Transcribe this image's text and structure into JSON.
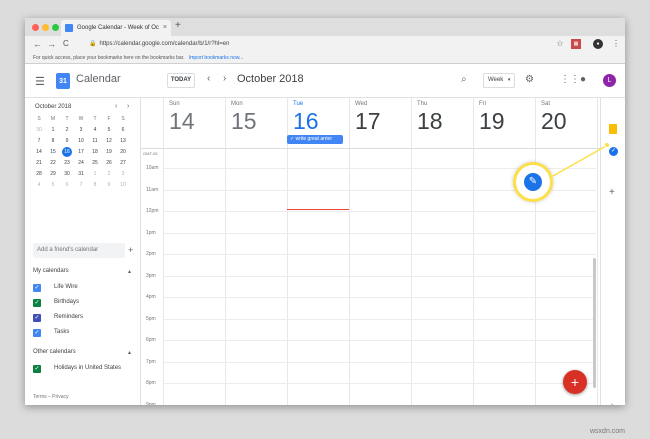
{
  "browser": {
    "tab_title": "Google Calendar - Week of Oc",
    "tab_close": "×",
    "new_tab": "+",
    "url": "https://calendar.google.com/calendar/b/1/r?hl=en",
    "back": "←",
    "forward": "→",
    "reload": "C",
    "bookmarks_text": "For quick access, place your bookmarks here on the bookmarks bar.",
    "bookmarks_link": "Import bookmarks now..."
  },
  "header": {
    "menu_icon": "menu-icon",
    "logo_day": "31",
    "app_title": "Calendar",
    "today_label": "TODAY",
    "prev": "‹",
    "next": "›",
    "month_title": "October 2018",
    "view_label": "Week",
    "avatar_letter": "L"
  },
  "mini_calendar": {
    "title": "October 2018",
    "weekdays": [
      "S",
      "M",
      "T",
      "W",
      "T",
      "F",
      "S"
    ],
    "days": [
      [
        "30",
        "1",
        "2",
        "3",
        "4",
        "5",
        "6"
      ],
      [
        "7",
        "8",
        "9",
        "10",
        "11",
        "12",
        "13"
      ],
      [
        "14",
        "15",
        "16",
        "17",
        "18",
        "19",
        "20"
      ],
      [
        "21",
        "22",
        "23",
        "24",
        "25",
        "26",
        "27"
      ],
      [
        "28",
        "29",
        "30",
        "31",
        "1",
        "2",
        "3"
      ],
      [
        "4",
        "5",
        "6",
        "7",
        "8",
        "9",
        "10"
      ]
    ],
    "today": "16"
  },
  "sidebar": {
    "friend_placeholder": "Add a friend's calendar",
    "my_calendars_title": "My calendars",
    "my_calendars": [
      {
        "label": "Life Wire",
        "color": "#4285f4"
      },
      {
        "label": "Birthdays",
        "color": "#0b8043"
      },
      {
        "label": "Reminders",
        "color": "#3f51b5"
      },
      {
        "label": "Tasks",
        "color": "#4285f4"
      }
    ],
    "other_calendars_title": "Other calendars",
    "other_calendars": [
      {
        "label": "Holidays in United States",
        "color": "#0b8043"
      }
    ],
    "terms": "Terms – Privacy"
  },
  "week": {
    "days": [
      {
        "name": "Sun",
        "num": "14"
      },
      {
        "name": "Mon",
        "num": "15"
      },
      {
        "name": "Tue",
        "num": "16"
      },
      {
        "name": "Wed",
        "num": "17"
      },
      {
        "name": "Thu",
        "num": "18"
      },
      {
        "name": "Fri",
        "num": "19"
      },
      {
        "name": "Sat",
        "num": "20"
      }
    ],
    "gmt": "GMT-05",
    "times": [
      "10am",
      "11am",
      "12pm",
      "1pm",
      "2pm",
      "3pm",
      "4pm",
      "5pm",
      "6pm",
      "7pm",
      "8pm",
      "9pm"
    ],
    "event_label": "write great arrier"
  },
  "fab_label": "+",
  "watermark": "wsxdn.com"
}
